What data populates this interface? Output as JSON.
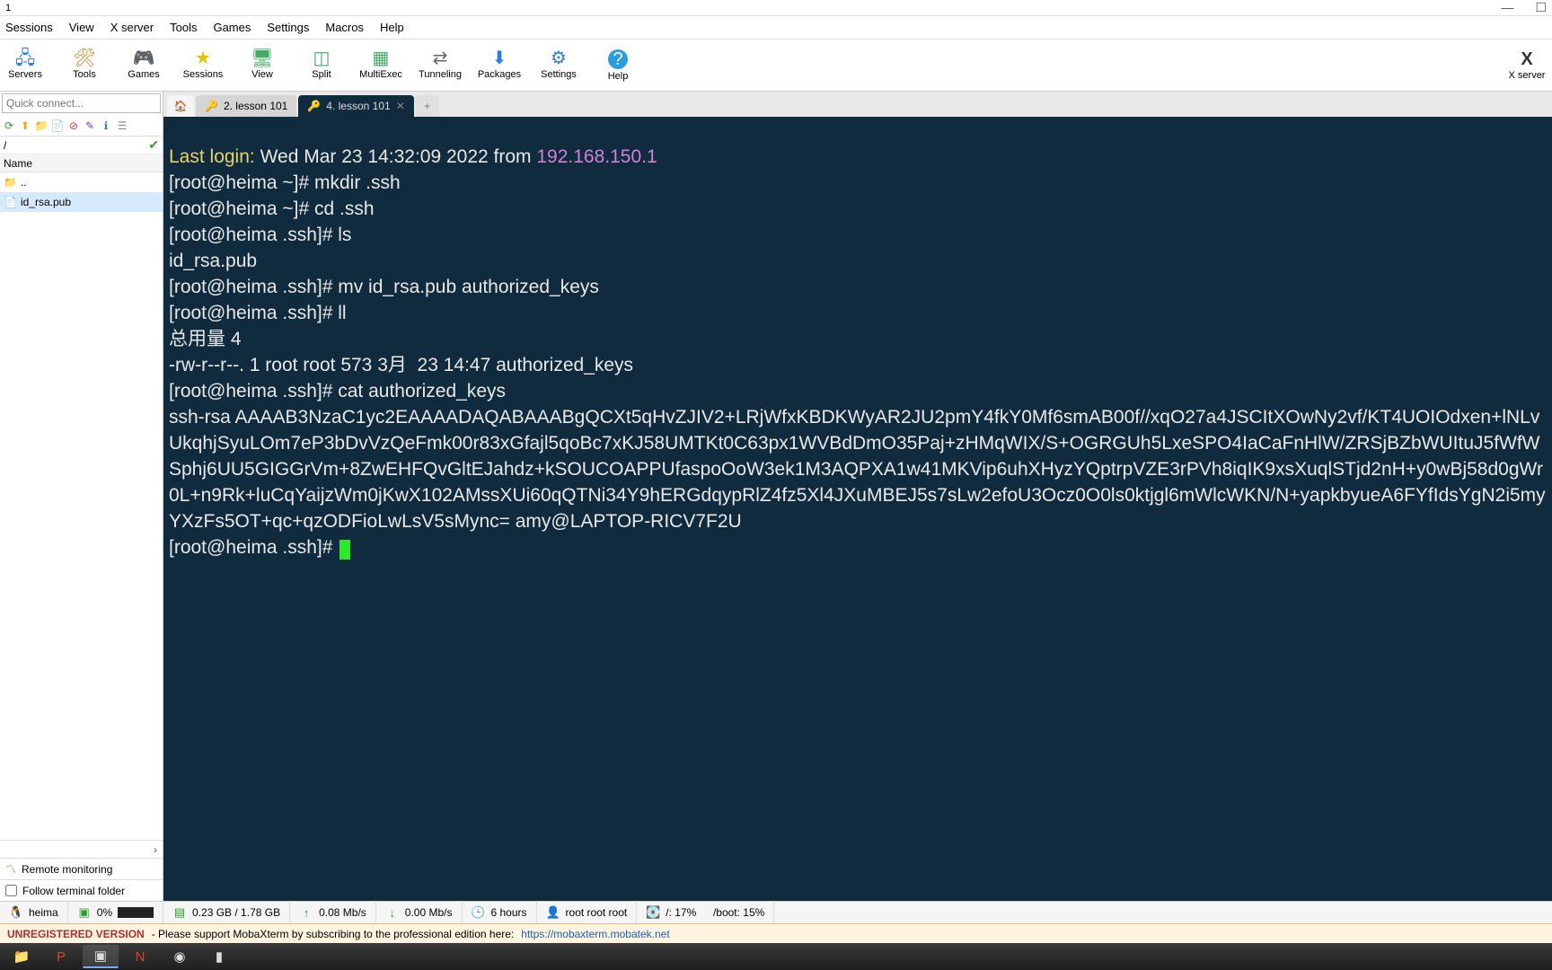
{
  "title": "1",
  "menus": [
    "Sessions",
    "View",
    "X server",
    "Tools",
    "Games",
    "Settings",
    "Macros",
    "Help"
  ],
  "tools": [
    {
      "label": "Servers",
      "icon": "🖧"
    },
    {
      "label": "Tools",
      "icon": "🛠"
    },
    {
      "label": "Games",
      "icon": "🎮"
    },
    {
      "label": "Sessions",
      "icon": "⭐"
    },
    {
      "label": "View",
      "icon": "🖥"
    },
    {
      "label": "Split",
      "icon": "◫"
    },
    {
      "label": "MultiExec",
      "icon": "▦"
    },
    {
      "label": "Tunneling",
      "icon": "↔"
    },
    {
      "label": "Packages",
      "icon": "📦"
    },
    {
      "label": "Settings",
      "icon": "⚙"
    },
    {
      "label": "Help",
      "icon": "?"
    }
  ],
  "tool_right": {
    "label": "X server",
    "icon": "✖"
  },
  "sidebar": {
    "quick_placeholder": "Quick connect...",
    "path": "/",
    "col": "Name",
    "items": [
      {
        "name": "..",
        "icon": "📁",
        "sel": false
      },
      {
        "name": "id_rsa.pub",
        "icon": "📄",
        "sel": true
      }
    ],
    "remote_label": "Remote monitoring",
    "follow_label": "Follow terminal folder"
  },
  "tabs": {
    "home_icon": "🏠",
    "inactive": "2. lesson 101",
    "active": "4. lesson 101",
    "new": "+"
  },
  "term": {
    "last_login_label": "Last login:",
    "last_login_time": " Wed Mar 23 14:32:09 2022 from ",
    "last_login_ip": "192.168.150.1",
    "l2": "[root@heima ~]# mkdir .ssh",
    "l3": "[root@heima ~]# cd .ssh",
    "l4": "[root@heima .ssh]# ls",
    "l5": "id_rsa.pub",
    "l6": "[root@heima .ssh]# mv id_rsa.pub authorized_keys",
    "l7": "[root@heima .ssh]# ll",
    "l8": "总用量 4",
    "l9": "-rw-r--r--. 1 root root 573 3月  23 14:47 authorized_keys",
    "l10": "[root@heima .ssh]# cat authorized_keys",
    "key": "ssh-rsa AAAAB3NzaC1yc2EAAAADAQABAAABgQCXt5qHvZJIV2+LRjWfxKBDKWyAR2JU2pmY4fkY0Mf6smAB00f//xqO27a4JSCItXOwNy2vf/KT4UOIOdxen+lNLvUkqhjSyuLOm7eP3bDvVzQeFmk00r83xGfajl5qoBc7xKJ58UMTKt0C63px1WVBdDmO35Paj+zHMqWIX/S+OGRGUh5LxeSPO4IaCaFnHlW/ZRSjBZbWUItuJ5fWfWSphj6UU5GIGGrVm+8ZwEHFQvGltEJahdz+kSOUCOAPPUfaspoOoW3ek1M3AQPXA1w41MKVip6uhXHyzYQptrpVZE3rPVh8iqIK9xsXuqlSTjd2nH+y0wBj58d0gWr0L+n9Rk+luCqYaijzWm0jKwX102AMssXUi60qQTNi34Y9hERGdqypRlZ4fz5Xl4JXuMBEJ5s7sLw2efoU3Ocz0O0ls0ktjgl6mWlcWKN/N+yapkbyueA6FYfIdsYgN2i5myYXzFs5OT+qc+qzODFioLwLsV5sMync= amy@LAPTOP-RICV7F2U",
    "prompt": "[root@heima .ssh]# "
  },
  "status": {
    "host": "heima",
    "cpu": "0%",
    "mem": "0.23 GB / 1.78 GB",
    "up": "0.08 Mb/s",
    "down": "0.00 Mb/s",
    "uptime": "6 hours",
    "user": "root  root  root",
    "disk1": "/: 17%",
    "disk2": "/boot: 15%"
  },
  "ad": {
    "tag": "UNREGISTERED VERSION",
    "text": "-   Please support MobaXterm by subscribing to the professional edition here:",
    "url": "https://mobaxterm.mobatek.net"
  }
}
